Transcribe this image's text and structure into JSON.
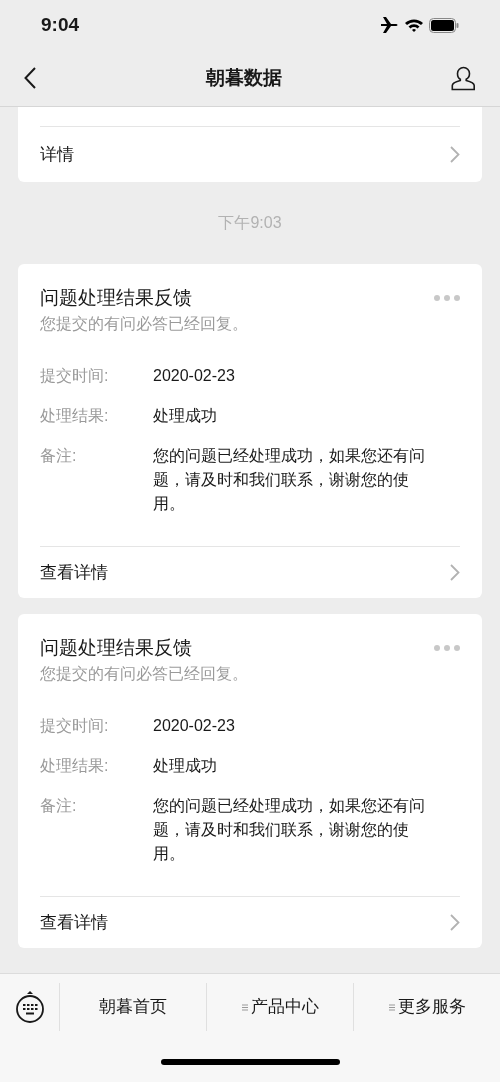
{
  "status_bar": {
    "time": "9:04"
  },
  "nav": {
    "title": "朝暮数据"
  },
  "previous_card": {
    "link": "详情"
  },
  "timestamp": "下午9:03",
  "messages": [
    {
      "title": "问题处理结果反馈",
      "subtitle": "您提交的有问必答已经回复。",
      "fields": [
        {
          "label": "提交时间:",
          "value": "2020-02-23"
        },
        {
          "label": "处理结果:",
          "value": "处理成功"
        },
        {
          "label": "备注:",
          "value": "您的问题已经处理成功，如果您还有问题，请及时和我们联系，谢谢您的使用。"
        }
      ],
      "link": "查看详情"
    },
    {
      "title": "问题处理结果反馈",
      "subtitle": "您提交的有问必答已经回复。",
      "fields": [
        {
          "label": "提交时间:",
          "value": "2020-02-23"
        },
        {
          "label": "处理结果:",
          "value": "处理成功"
        },
        {
          "label": "备注:",
          "value": "您的问题已经处理成功，如果您还有问题，请及时和我们联系，谢谢您的使用。"
        }
      ],
      "link": "查看详情"
    }
  ],
  "menu": [
    {
      "label": "朝暮首页",
      "kind": "link"
    },
    {
      "label": "产品中心",
      "kind": "submenu"
    },
    {
      "label": "更多服务",
      "kind": "submenu"
    }
  ]
}
